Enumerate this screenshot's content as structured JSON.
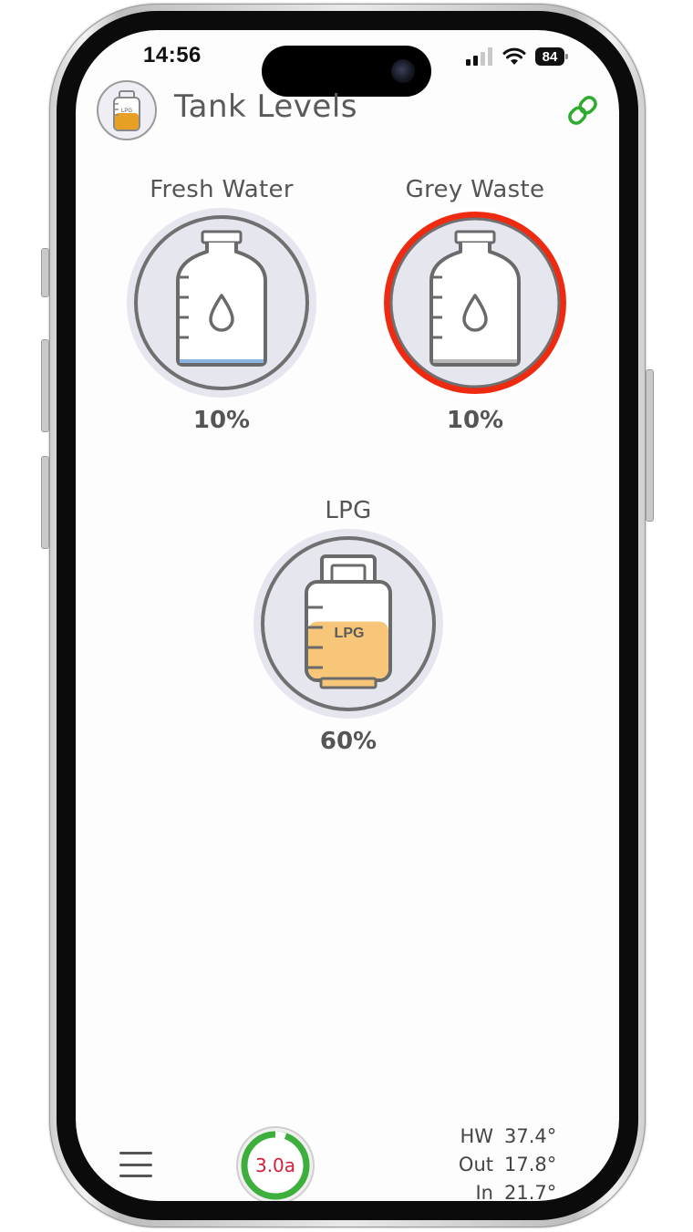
{
  "status_bar": {
    "time": "14:56",
    "battery": "84",
    "signal_icon": "signal-icon",
    "wifi_icon": "wifi-icon"
  },
  "header": {
    "title": "Tank Levels",
    "app_icon": "lpg-tank-icon",
    "app_icon_text": "LPG",
    "link_icon": "link-icon"
  },
  "tanks": [
    {
      "label": "Fresh Water",
      "value": "10%",
      "level": 0.1,
      "icon": "water-bottle-icon",
      "fill_color": "#8ab4e2",
      "alert": false
    },
    {
      "label": "Grey Waste",
      "value": "10%",
      "level": 0.1,
      "icon": "water-bottle-icon",
      "fill_color": "#b8b8b8",
      "alert": true,
      "alert_color": "#ee2a10"
    },
    {
      "label": "LPG",
      "value": "60%",
      "level": 0.6,
      "icon": "lpg-tank-icon",
      "icon_text": "LPG",
      "fill_color": "#f7c679",
      "alert": false
    }
  ],
  "bottom": {
    "menu_icon": "hamburger-menu-icon",
    "current": "3.0a",
    "current_ring_color": "#3caf3c",
    "temps": [
      {
        "label": "HW",
        "value": "37.4°"
      },
      {
        "label": "Out",
        "value": "17.8°"
      },
      {
        "label": "In",
        "value": "21.7°"
      }
    ]
  }
}
